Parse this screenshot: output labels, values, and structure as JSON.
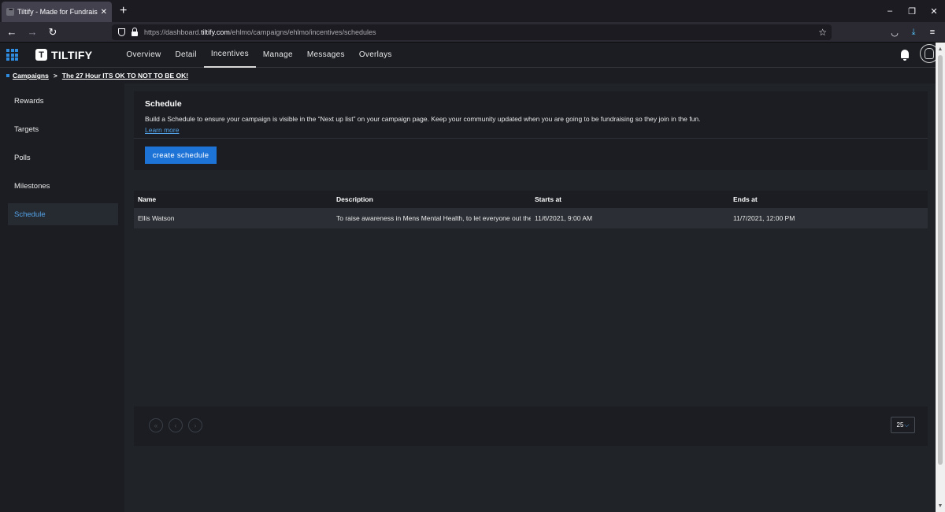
{
  "browser": {
    "tab_title": "Tiltify - Made for Fundraisers",
    "tab_close": "✕",
    "new_tab": "+",
    "url_prefix": "https://dashboard.",
    "url_host": "tiltify.com",
    "url_path": "/ehlmo/campaigns/ehlmo/incentives/schedules",
    "window_controls": [
      "–",
      "❐",
      "✕"
    ]
  },
  "header": {
    "logo_text": "TILTIFY",
    "logo_mark": "T",
    "nav": [
      {
        "label": "Overview",
        "active": false
      },
      {
        "label": "Detail",
        "active": false
      },
      {
        "label": "Incentives",
        "active": true
      },
      {
        "label": "Manage",
        "active": false
      },
      {
        "label": "Messages",
        "active": false
      },
      {
        "label": "Overlays",
        "active": false
      }
    ]
  },
  "breadcrumb": {
    "root": "Campaigns",
    "separator": ">",
    "current": "The 27 Hour ITS OK TO NOT TO BE OK!"
  },
  "sidebar": {
    "items": [
      {
        "label": "Rewards",
        "active": false
      },
      {
        "label": "Targets",
        "active": false
      },
      {
        "label": "Polls",
        "active": false
      },
      {
        "label": "Milestones",
        "active": false
      },
      {
        "label": "Schedule",
        "active": true
      }
    ]
  },
  "schedule": {
    "title": "Schedule",
    "description": "Build a Schedule to ensure your campaign is visible in the “Next up list” on your campaign page. Keep your community updated when you are going to be fundraising so they join in the fun.",
    "learn_more": "Learn more",
    "create_button": "create schedule"
  },
  "table": {
    "headers": [
      "Name",
      "Description",
      "Starts at",
      "Ends at"
    ],
    "rows": [
      {
        "name": "Ellis Watson",
        "description": "To raise awareness in Mens Mental Health, to let everyone out the",
        "starts_at": "11/6/2021, 9:00 AM",
        "ends_at": "11/7/2021, 12:00 PM"
      }
    ]
  },
  "pagination": {
    "per_page": "25",
    "buttons": [
      "«",
      "‹",
      "›"
    ]
  },
  "colors": {
    "accent": "#1e73d6",
    "link": "#54a3e8",
    "background": "#202328",
    "panel": "#1b1d22"
  }
}
